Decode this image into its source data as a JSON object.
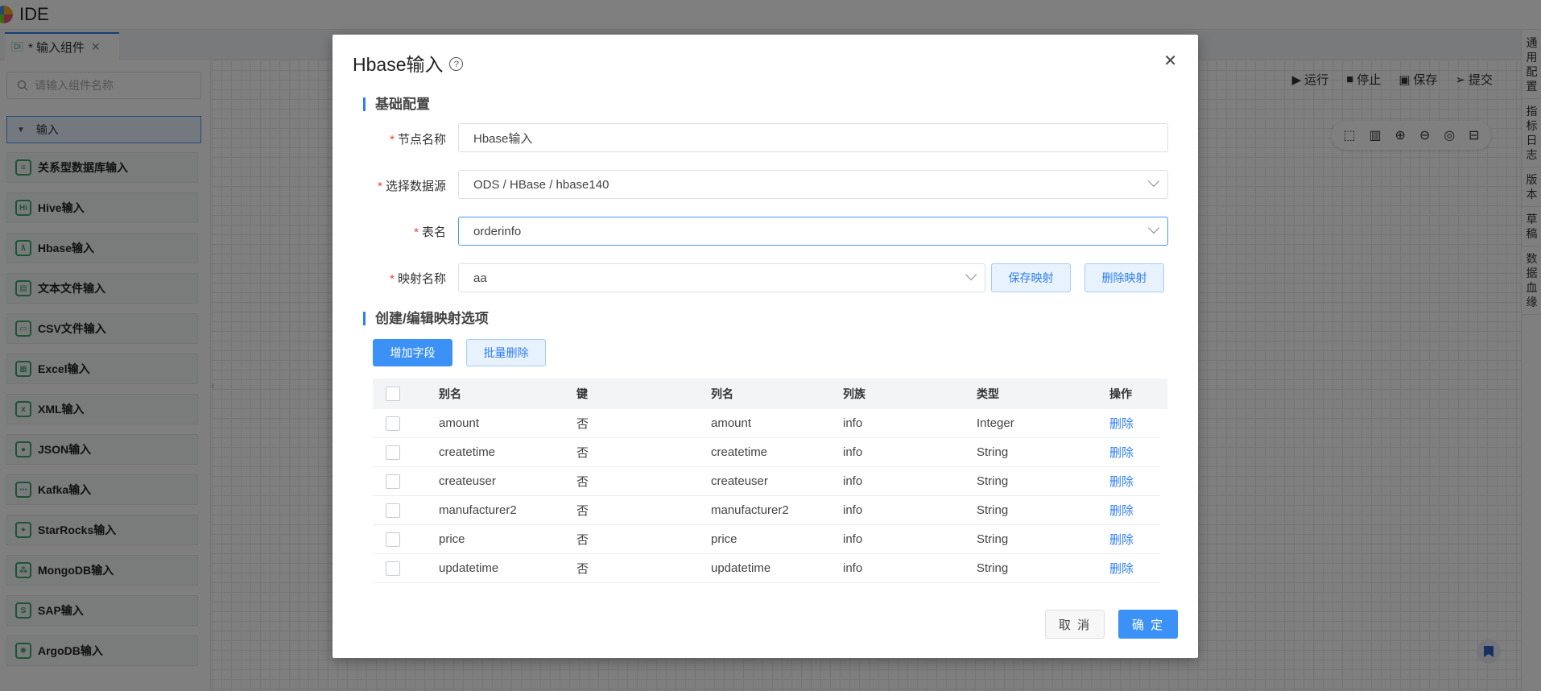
{
  "app": {
    "title": "IDE"
  },
  "tab": {
    "badge": "DI",
    "label": "* 输入组件",
    "close": "✕"
  },
  "sidebar": {
    "search_placeholder": "请输入组件名称",
    "group_label": "输入",
    "items": [
      {
        "label": "关系型数据库输入",
        "icon": "database-icon",
        "glyph": "≡"
      },
      {
        "label": "Hive输入",
        "icon": "hive-icon",
        "glyph": "Hi"
      },
      {
        "label": "Hbase输入",
        "icon": "hbase-icon",
        "glyph": "ƛ"
      },
      {
        "label": "文本文件输入",
        "icon": "text-file-icon",
        "glyph": "▤"
      },
      {
        "label": "CSV文件输入",
        "icon": "csv-file-icon",
        "glyph": "▭"
      },
      {
        "label": "Excel输入",
        "icon": "excel-icon",
        "glyph": "▦"
      },
      {
        "label": "XML输入",
        "icon": "xml-icon",
        "glyph": "x"
      },
      {
        "label": "JSON输入",
        "icon": "json-icon",
        "glyph": "●"
      },
      {
        "label": "Kafka输入",
        "icon": "kafka-icon",
        "glyph": "⋯"
      },
      {
        "label": "StarRocks输入",
        "icon": "starrocks-icon",
        "glyph": "✦"
      },
      {
        "label": "MongoDB输入",
        "icon": "mongodb-icon",
        "glyph": "⁂"
      },
      {
        "label": "SAP输入",
        "icon": "sap-icon",
        "glyph": "S"
      },
      {
        "label": "ArgoDB输入",
        "icon": "argodb-icon",
        "glyph": "✺"
      }
    ]
  },
  "toolbar": {
    "run": "运行",
    "stop": "停止",
    "save": "保存",
    "submit": "提交"
  },
  "right_rail": [
    "通用配置",
    "指标日志",
    "版本",
    "草稿",
    "数据血缘"
  ],
  "modal": {
    "title": "Hbase输入",
    "section_basic": "基础配置",
    "section_mapping": "创建/编辑映射选项",
    "fields": {
      "node_name_label": "节点名称",
      "node_name_value": "Hbase输入",
      "datasource_label": "选择数据源",
      "datasource_value": "ODS / HBase / hbase140",
      "table_label": "表名",
      "table_value": "orderinfo",
      "mapping_label": "映射名称",
      "mapping_value": "aa"
    },
    "buttons": {
      "save_mapping": "保存映射",
      "delete_mapping": "删除映射",
      "add_field": "增加字段",
      "batch_delete": "批量删除",
      "cancel": "取 消",
      "confirm": "确 定"
    },
    "table": {
      "headers": [
        "别名",
        "键",
        "列名",
        "列族",
        "类型",
        "操作"
      ],
      "rows": [
        {
          "alias": "amount",
          "key": "否",
          "column": "amount",
          "family": "info",
          "type": "Integer",
          "op": "删除"
        },
        {
          "alias": "createtime",
          "key": "否",
          "column": "createtime",
          "family": "info",
          "type": "String",
          "op": "删除"
        },
        {
          "alias": "createuser",
          "key": "否",
          "column": "createuser",
          "family": "info",
          "type": "String",
          "op": "删除"
        },
        {
          "alias": "manufacturer2",
          "key": "否",
          "column": "manufacturer2",
          "family": "info",
          "type": "String",
          "op": "删除"
        },
        {
          "alias": "price",
          "key": "否",
          "column": "price",
          "family": "info",
          "type": "String",
          "op": "删除"
        },
        {
          "alias": "updatetime",
          "key": "否",
          "column": "updatetime",
          "family": "info",
          "type": "String",
          "op": "删除"
        }
      ]
    }
  }
}
